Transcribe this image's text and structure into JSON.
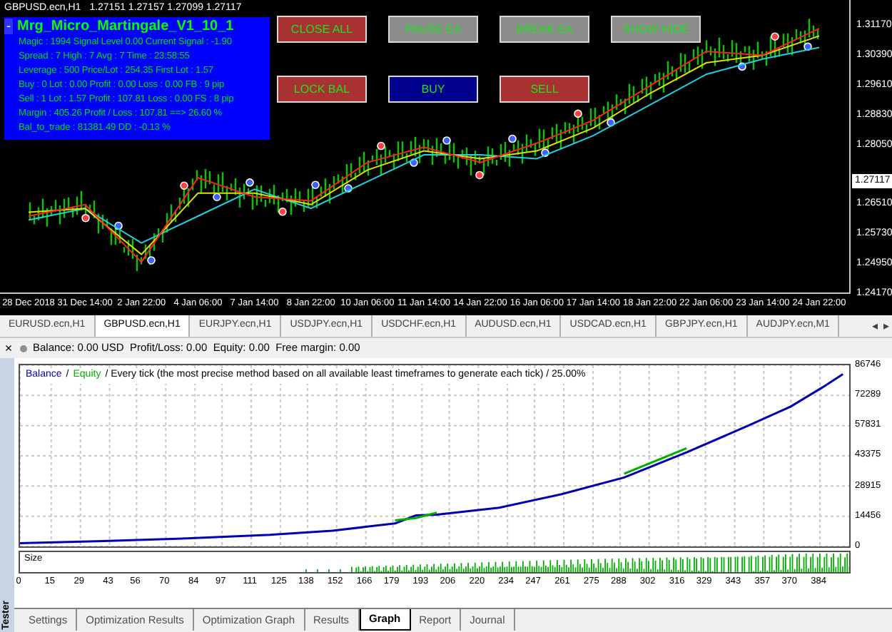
{
  "chart_window": {
    "symbol": "GBPUSD.ecn,H1",
    "quote": "1.27151 1.27157 1.27099 1.27117",
    "info_panel": {
      "collapse": "-",
      "title": "Mrg_Micro_Martingale_V1_10_1",
      "lines": [
        "Magic : 1994 Signal Level 0.00 Current Signal : -1.90",
        "Spread  : 7 High : 7 Avg : 7  Time : 23:58:55",
        "Leverage : 500 Price/Lot : 254.35  First Lot : 1.57",
        "Buy  : 0 Lot : 0.00 Profit : 0.00 Loss : 0.00 FB : 9 pip",
        "Sell  : 1 Lot : 1.57 Profit : 107.81 Loss : 0.00 FS : 8 pip",
        "Margin : 405.26 Profit / Loss : 107.81 ==> 26.60 %",
        "Bal_to_trade : 81381.49  DD  : -0.13 %"
      ]
    },
    "buttons": [
      {
        "label": "CLOSE ALL",
        "color": "#a83232"
      },
      {
        "label": "PAUSE EA",
        "color": "#8c8c8c"
      },
      {
        "label": "BREAK EA",
        "color": "#8c8c8c"
      },
      {
        "label": "SHOW HIDE",
        "color": "#8c8c8c"
      },
      {
        "label": "LOCK BAL",
        "color": "#a83232"
      },
      {
        "label": "BUY",
        "color": "#00008c"
      },
      {
        "label": "SELL",
        "color": "#a83232"
      }
    ],
    "current_price": "1.27117",
    "chart_data": {
      "type": "line",
      "categories": [
        "28 Dec 2018",
        "31 Dec 14:00",
        "2 Jan 22:00",
        "4 Jan 06:00",
        "7 Jan 14:00",
        "8 Jan 22:00",
        "10 Jan 06:00",
        "11 Jan 14:00",
        "14 Jan 22:00",
        "16 Jan 06:00",
        "17 Jan 14:00",
        "18 Jan 22:00",
        "22 Jan 06:00",
        "23 Jan 14:00",
        "24 Jan 22:00"
      ],
      "series": [
        {
          "color": "#ff2020",
          "values": [
            1.262,
            1.265,
            1.25,
            1.272,
            1.267,
            1.266,
            1.276,
            1.28,
            1.276,
            1.281,
            1.287,
            1.296,
            1.305,
            1.304,
            1.311
          ]
        },
        {
          "color": "#e0e000",
          "values": [
            1.263,
            1.264,
            1.252,
            1.268,
            1.268,
            1.265,
            1.274,
            1.279,
            1.277,
            1.279,
            1.285,
            1.294,
            1.302,
            1.304,
            1.309
          ]
        },
        {
          "color": "#20d0e0",
          "values": [
            1.261,
            1.264,
            1.255,
            1.262,
            1.269,
            1.264,
            1.271,
            1.278,
            1.278,
            1.277,
            1.283,
            1.291,
            1.299,
            1.303,
            1.306
          ]
        }
      ],
      "ylim": [
        1.2417,
        1.3184
      ],
      "yticks": [
        {
          "value": 1.3117,
          "label": "1.31170"
        },
        {
          "value": 1.3039,
          "label": "1.30390"
        },
        {
          "value": 1.2961,
          "label": "1.29610"
        },
        {
          "value": 1.2883,
          "label": "1.28830"
        },
        {
          "value": 1.2805,
          "label": "1.28050"
        },
        {
          "value": 1.2651,
          "label": "1.26510"
        },
        {
          "value": 1.2573,
          "label": "1.25730"
        },
        {
          "value": 1.2495,
          "label": "1.24950"
        },
        {
          "value": 1.2417,
          "label": "1.24170"
        }
      ]
    }
  },
  "chart_tabs": [
    {
      "label": "EURUSD.ecn,H1",
      "selected": false
    },
    {
      "label": "GBPUSD.ecn,H1",
      "selected": true
    },
    {
      "label": "EURJPY.ecn,H1",
      "selected": false
    },
    {
      "label": "USDJPY.ecn,H1",
      "selected": false
    },
    {
      "label": "USDCHF.ecn,H1",
      "selected": false
    },
    {
      "label": "AUDUSD.ecn,H1",
      "selected": false
    },
    {
      "label": "USDCAD.ecn,H1",
      "selected": false
    },
    {
      "label": "GBPJPY.ecn,H1",
      "selected": false
    },
    {
      "label": "AUDJPY.ecn,M1",
      "selected": false
    }
  ],
  "tab_scroll": [
    "◂",
    "▸"
  ],
  "account_bar": {
    "close": "×",
    "text": "Balance: 0.00 USD  Profit/Loss: 0.00  Equity: 0.00  Free margin: 0.00"
  },
  "tester": {
    "title": "Tester",
    "graph": {
      "chart_data": {
        "type": "line",
        "x": [
          0,
          40,
          80,
          120,
          150,
          180,
          190,
          200,
          230,
          260,
          290,
          320,
          350,
          370,
          385,
          395
        ],
        "series": [
          {
            "name": "Balance",
            "color": "#0000b0",
            "values": [
              1500,
              2500,
              3800,
              5500,
              7500,
              11000,
              14800,
              15200,
              18500,
              25000,
              33000,
              45000,
              58000,
              67000,
              76000,
              82500
            ]
          },
          {
            "name": "Equity",
            "color": "#00b000",
            "values": [
              null,
              null,
              null,
              null,
              null,
              12500,
              13600,
              16200,
              null,
              null,
              34800,
              47000,
              null,
              null,
              null,
              null
            ]
          }
        ],
        "xlim": [
          0,
          398
        ],
        "ylim": [
          0,
          86746
        ],
        "grid": true,
        "xticks": [
          0,
          15,
          29,
          43,
          56,
          70,
          84,
          97,
          111,
          125,
          138,
          152,
          166,
          179,
          193,
          206,
          220,
          234,
          247,
          261,
          275,
          288,
          302,
          316,
          329,
          343,
          357,
          370,
          384
        ],
        "yticks": [
          0,
          14456,
          28915,
          43375,
          57831,
          72289,
          86746
        ]
      },
      "separator": "/",
      "description": "/ Every tick (the most precise method based on all available least timeframes to generate each tick) / 25.00%",
      "size_label": "Size"
    },
    "tabs": [
      {
        "label": "Settings",
        "selected": false
      },
      {
        "label": "Optimization Results",
        "selected": false
      },
      {
        "label": "Optimization Graph",
        "selected": false
      },
      {
        "label": "Results",
        "selected": false
      },
      {
        "label": "Graph",
        "selected": true
      },
      {
        "label": "Report",
        "selected": false
      },
      {
        "label": "Journal",
        "selected": false
      }
    ]
  }
}
